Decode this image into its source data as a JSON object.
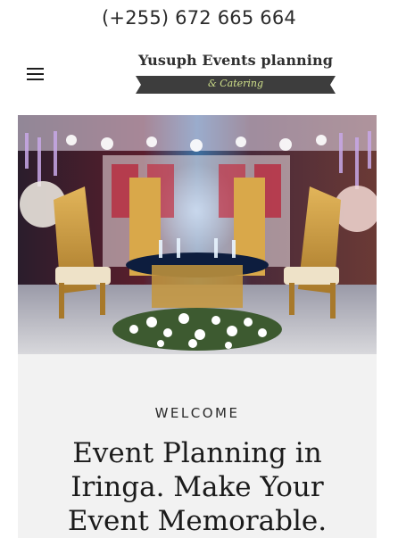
{
  "header": {
    "phone": "(+255) 672 665 664",
    "logo_title": "Yusuph Events planning",
    "logo_subtitle": "& Catering",
    "menu_icon": "hamburger-menu-icon"
  },
  "hero": {
    "image_description_icon": "event-decor-photo"
  },
  "welcome": {
    "label": "WELCOME",
    "headline": "Event Planning in Iringa. Make Your Event Memorable."
  },
  "colors": {
    "logo_banner": "#3d3d3d",
    "logo_subtitle": "#cfe08a",
    "panel_bg": "#f2f2f2",
    "text": "#1b1b1b"
  }
}
